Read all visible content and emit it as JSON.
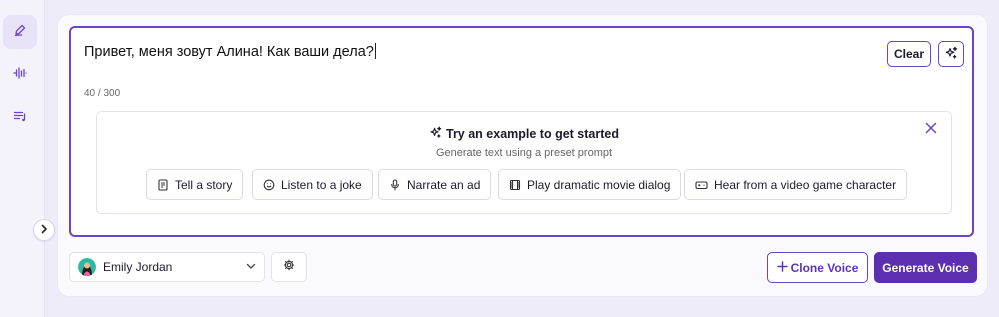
{
  "sidebar": {
    "items": [
      {
        "icon": "pen-icon",
        "active": true
      },
      {
        "icon": "waveform-icon",
        "active": false
      },
      {
        "icon": "playlist-icon",
        "active": false
      }
    ]
  },
  "editor": {
    "text": "Привет, меня зовут Алина! Как ваши дела?",
    "counter": "40 / 300",
    "clear_label": "Clear"
  },
  "examples": {
    "title": "Try an example to get started",
    "subtitle": "Generate text using a preset prompt",
    "chips": [
      {
        "label": "Tell a story",
        "icon": "book-icon"
      },
      {
        "label": "Listen to a joke",
        "icon": "smile-icon"
      },
      {
        "label": "Narrate an ad",
        "icon": "microphone-icon"
      },
      {
        "label": "Play dramatic movie dialog",
        "icon": "film-icon"
      },
      {
        "label": "Hear from a video game character",
        "icon": "gamepad-icon"
      }
    ]
  },
  "footer": {
    "voice_name": "Emily Jordan",
    "clone_label": "Clone Voice",
    "generate_label": "Generate Voice"
  },
  "colors": {
    "accent": "#6b45c8",
    "primary_button": "#5b2fb0",
    "background": "#efecf9"
  }
}
